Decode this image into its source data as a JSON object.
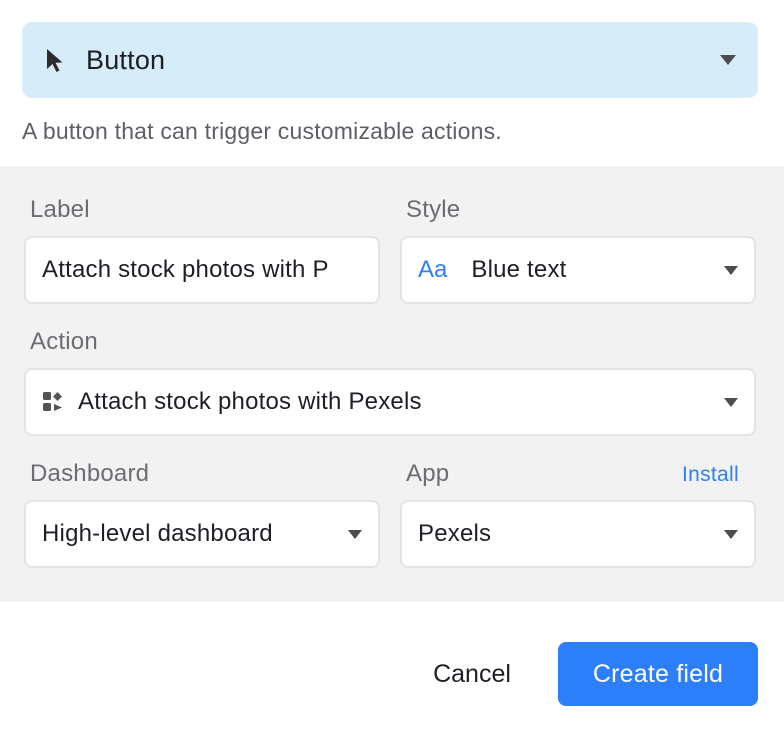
{
  "field_type": {
    "icon": "cursor-arrow-icon",
    "label": "Button",
    "description": "A button that can trigger customizable actions.",
    "background_color": "#d6edf9"
  },
  "options": {
    "label_field": {
      "label": "Label",
      "value": "Attach stock photos with P"
    },
    "style_field": {
      "label": "Style",
      "icon_text": "Aa",
      "value": "Blue text"
    },
    "action_field": {
      "label": "Action",
      "icon": "apps-icon",
      "value": "Attach stock photos with Pexels"
    },
    "dashboard_field": {
      "label": "Dashboard",
      "value": "High-level dashboard"
    },
    "app_field": {
      "label": "App",
      "install_label": "Install",
      "value": "Pexels"
    }
  },
  "footer": {
    "cancel_label": "Cancel",
    "create_label": "Create field"
  },
  "colors": {
    "accent": "#2d7ff9",
    "panel_background": "#f2f2f2"
  }
}
